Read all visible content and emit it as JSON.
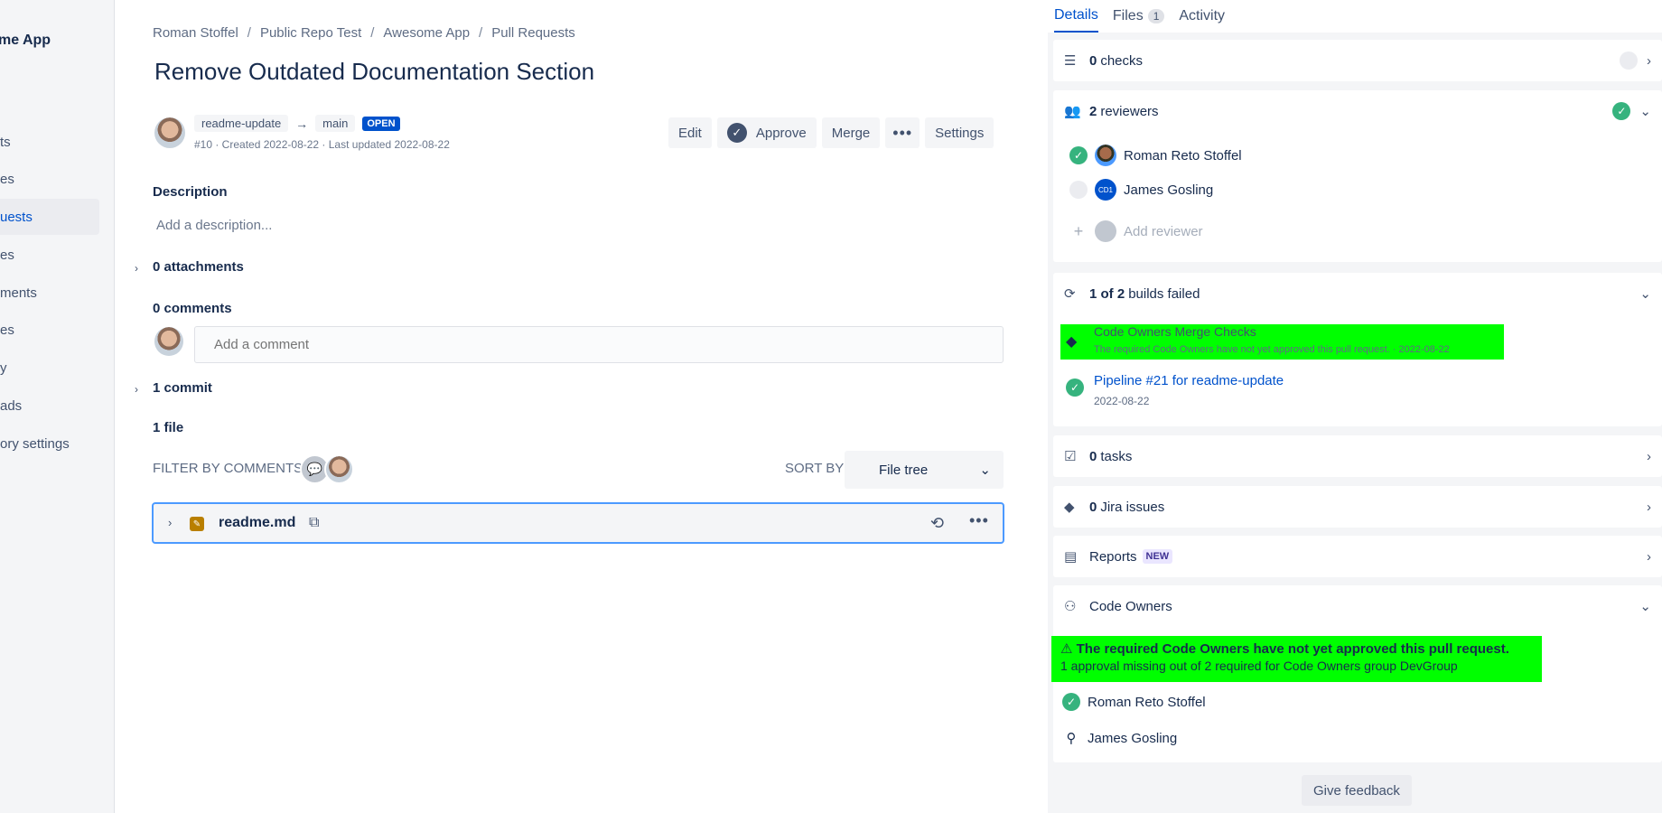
{
  "sidebar": {
    "title": "me App",
    "items": [
      {
        "label": "ts"
      },
      {
        "label": "es"
      },
      {
        "label": "uests"
      },
      {
        "label": "es"
      },
      {
        "label": "ments"
      },
      {
        "label": "es"
      },
      {
        "label": "y"
      },
      {
        "label": "ads"
      },
      {
        "label": "ory settings"
      }
    ]
  },
  "breadcrumb": [
    "Roman Stoffel",
    "Public Repo Test",
    "Awesome App",
    "Pull Requests"
  ],
  "pr": {
    "title": "Remove Outdated Documentation Section",
    "source_branch": "readme-update",
    "target_branch": "main",
    "state": "OPEN",
    "meta": "#10 · Created 2022-08-22 · Last updated 2022-08-22",
    "actions": {
      "edit": "Edit",
      "approve": "Approve",
      "merge": "Merge",
      "more": "•••",
      "settings": "Settings"
    }
  },
  "description": {
    "heading": "Description",
    "placeholder": "Add a description..."
  },
  "attachments": "0 attachments",
  "comments": {
    "heading": "0 comments",
    "placeholder": "Add a comment"
  },
  "commits": "1 commit",
  "files": {
    "heading": "1 file",
    "filter_label": "FILTER BY COMMENTS",
    "sort_label": "SORT BY",
    "sort_value": "File tree",
    "rows": [
      {
        "name": "readme.md"
      }
    ]
  },
  "panel": {
    "tabs": [
      {
        "label": "Details",
        "active": true
      },
      {
        "label": "Files",
        "badge": "1"
      },
      {
        "label": "Activity"
      }
    ],
    "checks": {
      "count": "0",
      "label": "checks"
    },
    "reviewers": {
      "count": "2",
      "label": "reviewers",
      "list": [
        {
          "name": "Roman Reto Stoffel",
          "approved": true
        },
        {
          "name": "James Gosling",
          "initials": "CD1",
          "approved": false
        }
      ],
      "add_label": "Add reviewer"
    },
    "builds": {
      "summary_bold": "1 of 2",
      "summary_rest": "builds failed",
      "items": [
        {
          "title": "Code Owners Merge Checks",
          "subtitle": "The required Code Owners have not yet approved this pull request.  ·  2022-08-22"
        },
        {
          "title": "Pipeline #21 for readme-update",
          "subtitle": "2022-08-22"
        }
      ]
    },
    "tasks": {
      "count": "0",
      "label": "tasks"
    },
    "jira": {
      "count": "0",
      "label": "Jira issues"
    },
    "reports": {
      "label": "Reports",
      "badge": "NEW"
    },
    "code_owners": {
      "label": "Code Owners",
      "warning_title": "The required Code Owners have not yet approved this pull request.",
      "warning_detail": "1 approval missing out of 2 required for Code Owners group DevGroup",
      "users": [
        {
          "name": "Roman Reto Stoffel"
        },
        {
          "name": "James Gosling"
        }
      ]
    },
    "feedback": "Give feedback"
  },
  "colors": {
    "accent": "#0052cc",
    "success": "#36b37e",
    "highlight": "#00ff00"
  }
}
